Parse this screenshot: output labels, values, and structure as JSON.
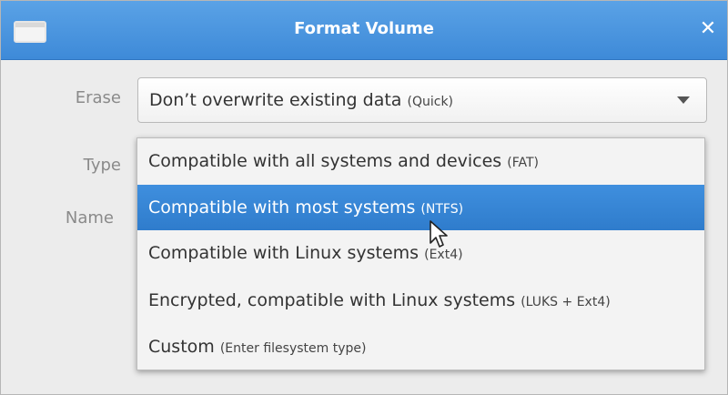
{
  "window": {
    "title": "Format Volume",
    "close_symbol": "✕",
    "titlebar_color": "#3e8ad8"
  },
  "form": {
    "erase_label": "Erase",
    "type_label": "Type",
    "name_label": "Name",
    "erase_select": {
      "main": "Don’t overwrite existing data ",
      "detail": "(Quick)"
    }
  },
  "type_dropdown": {
    "selected_index": 1,
    "options": [
      {
        "main": "Compatible with all systems and devices ",
        "detail": "(FAT)"
      },
      {
        "main": "Compatible with most systems ",
        "detail": "(NTFS)"
      },
      {
        "main": "Compatible with Linux systems ",
        "detail": "(Ext4)"
      },
      {
        "main": "Encrypted, compatible with Linux systems ",
        "detail": "(LUKS + Ext4)"
      },
      {
        "main": "Custom ",
        "detail": "(Enter filesystem type)"
      }
    ],
    "highlight_color": "#3a88d8"
  },
  "icons": {
    "window_icon": "window-icon",
    "close": "close-icon",
    "dropdown_arrow": "chevron-down-icon",
    "cursor": "mouse-pointer-icon"
  }
}
